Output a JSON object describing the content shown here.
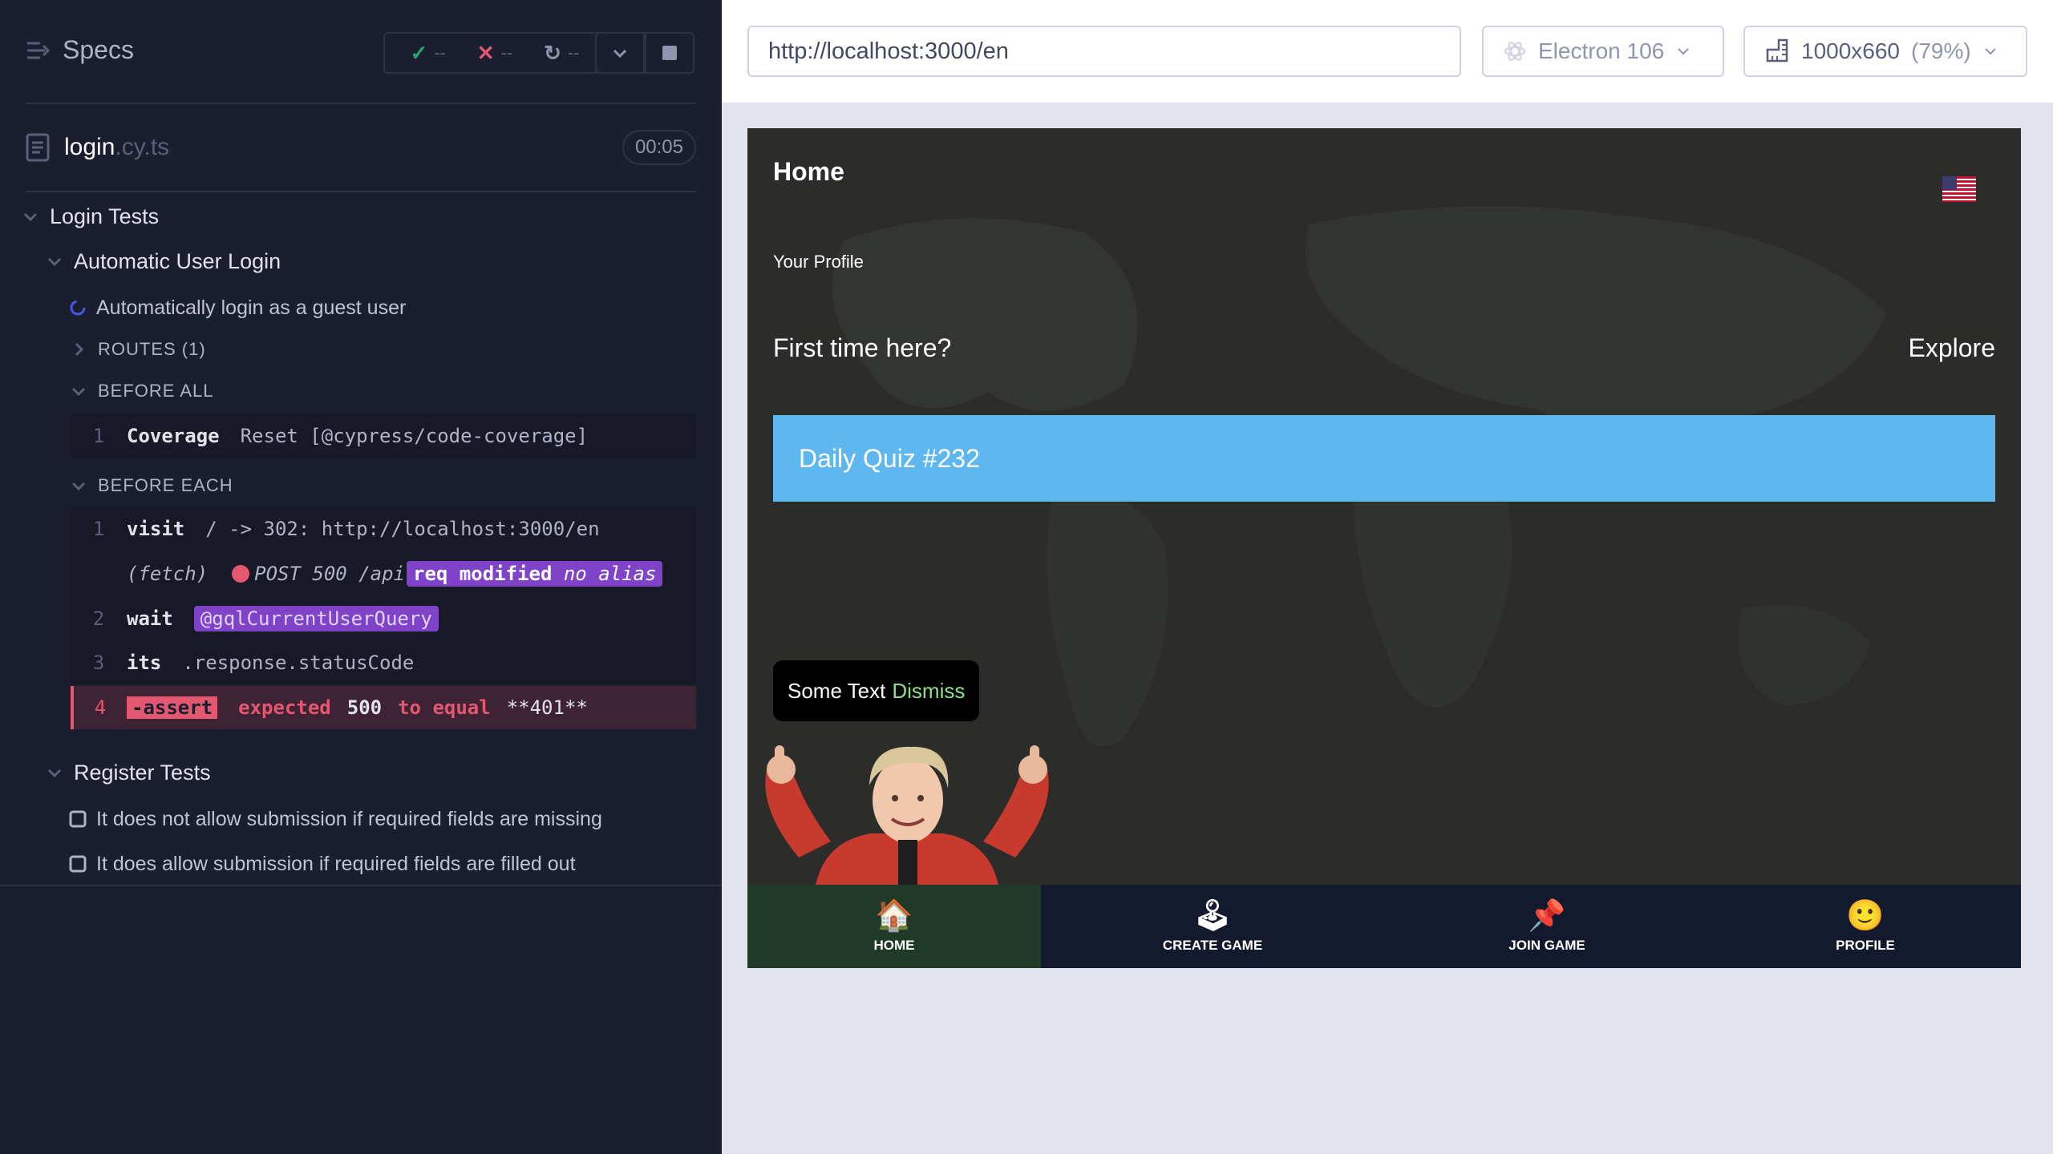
{
  "reporter": {
    "specs_label": "Specs",
    "stats": {
      "passed": "--",
      "failed": "--",
      "pending": "--"
    },
    "file": {
      "name": "login",
      "ext": ".cy.ts",
      "duration": "00:05"
    },
    "suites": {
      "root": "Login Tests",
      "auto": "Automatic User Login",
      "auto_test": "Automatically login as a guest user",
      "routes": "ROUTES (1)",
      "before_all": "BEFORE ALL",
      "before_each": "BEFORE EACH",
      "register": "Register Tests",
      "reg_test1": "It does not allow submission if required fields are missing",
      "reg_test2": "It does allow submission if required fields are filled out"
    },
    "before_all_cmds": [
      {
        "num": "1",
        "name": "Coverage",
        "msg": "Reset [@cypress/code-coverage]"
      }
    ],
    "before_each_cmds": [
      {
        "num": "1",
        "name": "visit",
        "msg": "/ -> 302: http://localhost:3000/en"
      },
      {
        "num": "",
        "name": "(fetch)",
        "msg": "POST 500 /api",
        "pill_a": "req modified",
        "pill_b": "no alias"
      },
      {
        "num": "2",
        "name": "wait",
        "msg": "@gqlCurrentUserQuery"
      },
      {
        "num": "3",
        "name": "its",
        "msg": ".response.statusCode"
      },
      {
        "num": "4",
        "name": "-assert",
        "msg_a": "expected",
        "msg_b": "500",
        "msg_c": "to equal",
        "msg_d": "**401**"
      }
    ]
  },
  "browser": {
    "url": "http://localhost:3000/en",
    "browser_name": "Electron 106",
    "viewport": "1000x660",
    "zoom": "(79%)"
  },
  "app": {
    "home_title": "Home",
    "profile_link": "Your Profile",
    "first_time": "First time here?",
    "explore": "Explore",
    "quiz": "Daily Quiz #232",
    "toast_text": "Some Text",
    "toast_action": "Dismiss",
    "tabs": [
      {
        "label": "HOME",
        "icon": "house-icon"
      },
      {
        "label": "CREATE GAME",
        "icon": "joystick-icon"
      },
      {
        "label": "JOIN GAME",
        "icon": "pushpin-icon"
      },
      {
        "label": "PROFILE",
        "icon": "face-icon"
      }
    ],
    "colors": {
      "quiz_bg": "#5fb7ef",
      "tabbar_bg": "#141a2e",
      "active_tab_bg": "#203a2a",
      "dismiss": "#8de08b"
    }
  }
}
